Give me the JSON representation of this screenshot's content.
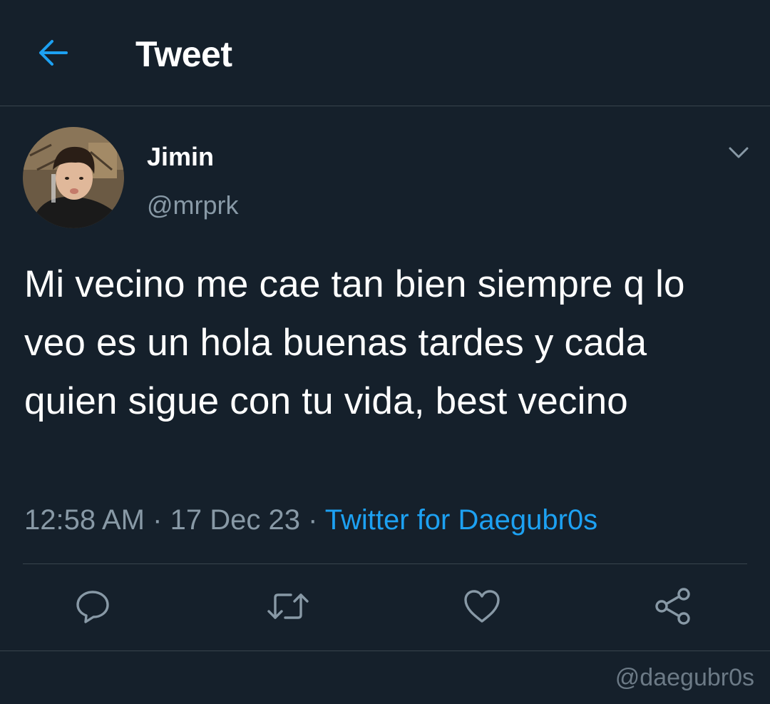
{
  "header": {
    "title": "Tweet",
    "back_icon": "arrow-left-icon"
  },
  "colors": {
    "background": "#15202b",
    "accent": "#1da1f2",
    "secondary_text": "#8899a6",
    "divider": "#38444d"
  },
  "tweet": {
    "author": {
      "name": "Jimin",
      "handle": "@mrprk"
    },
    "text": "Mi vecino me cae tan bien siempre q lo veo es un hola buenas tardes y cada quien sigue con tu vida, best vecino",
    "time": "12:58 AM",
    "date": "17 Dec 23",
    "separator": "·",
    "source": "Twitter for Daegubr0s"
  },
  "actions": [
    {
      "icon": "reply-icon"
    },
    {
      "icon": "retweet-icon"
    },
    {
      "icon": "like-icon"
    },
    {
      "icon": "share-icon"
    }
  ],
  "watermark": "@daegubr0s"
}
